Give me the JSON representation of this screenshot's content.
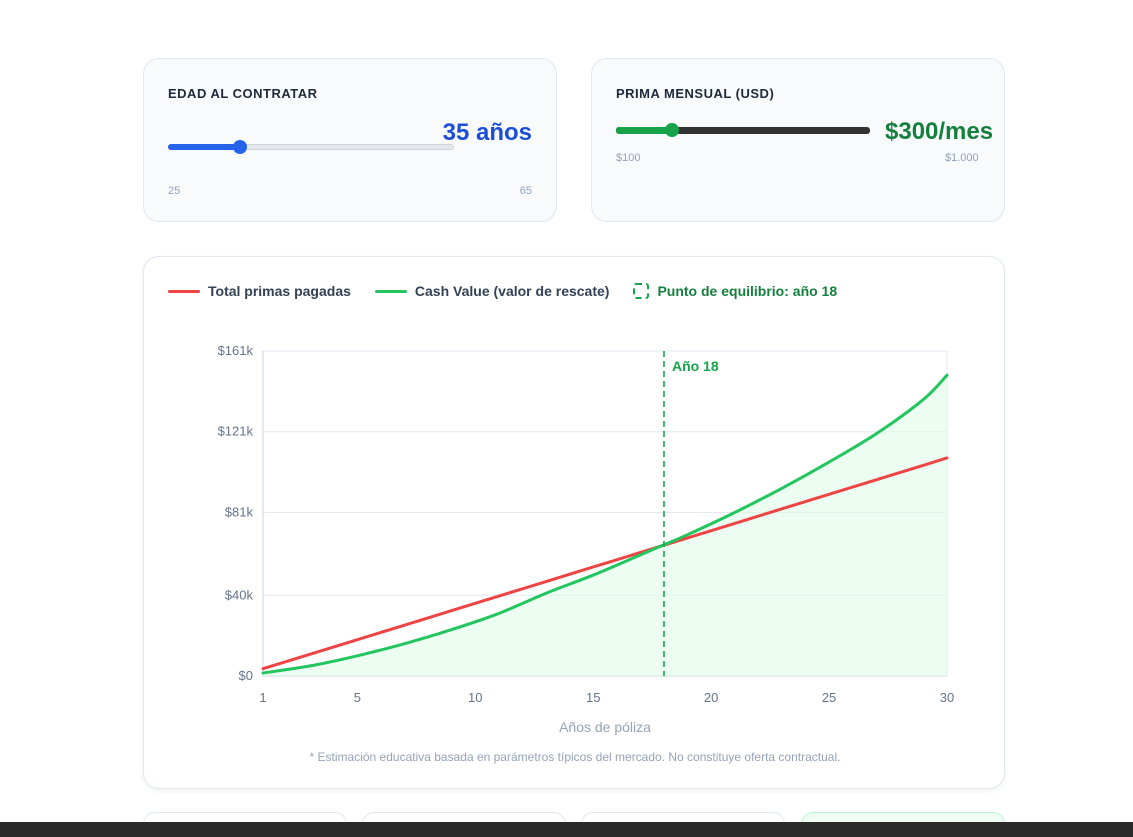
{
  "age": {
    "title": "EDAD AL CONTRATAR",
    "value": 35,
    "min": 25,
    "max": 65,
    "display": "35 años",
    "min_label": "25",
    "max_label": "65",
    "accent": "#1d4ed8"
  },
  "premium": {
    "title": "PRIMA MENSUAL (USD)",
    "value": 300,
    "min": 100,
    "max": 1000,
    "display": "$300/mes",
    "min_label": "$100",
    "max_label": "$1.000",
    "accent": "#16a34a"
  },
  "legend": {
    "premiums": "Total primas pagadas",
    "cash_value": "Cash Value (valor de rescate)",
    "breakeven": "Punto de equilibrio: año 18"
  },
  "footnote": "* Estimación educativa basada en parámetros típicos del mercado. No constituye oferta contractual.",
  "chart_data": {
    "type": "line",
    "xlabel": "Años de póliza",
    "ylabel": "",
    "xlim": [
      1,
      30
    ],
    "ylim": [
      0,
      161
    ],
    "x_ticks": [
      1,
      5,
      10,
      15,
      20,
      25,
      30
    ],
    "y_ticks": [
      {
        "value": 0,
        "label": "$0"
      },
      {
        "value": 40,
        "label": "$40k"
      },
      {
        "value": 81,
        "label": "$81k"
      },
      {
        "value": 121,
        "label": "$121k"
      },
      {
        "value": 161,
        "label": "$161k"
      }
    ],
    "x": [
      1,
      3,
      5,
      7,
      9,
      11,
      13,
      15,
      17,
      18,
      19,
      21,
      23,
      25,
      27,
      29,
      30
    ],
    "series": [
      {
        "name": "Total primas pagadas",
        "color": "#ef4444",
        "values": [
          3.6,
          10.8,
          18,
          25.2,
          32.4,
          39.6,
          46.8,
          54,
          61.2,
          64.8,
          68.4,
          75.6,
          82.8,
          90,
          97.2,
          104.4,
          108
        ]
      },
      {
        "name": "Cash Value (valor de rescate)",
        "color": "#22c55e",
        "values": [
          1.5,
          5,
          10,
          16,
          23,
          31,
          41,
          50,
          60,
          65,
          70,
          81,
          93,
          106,
          120,
          137,
          149
        ]
      }
    ],
    "breakeven": {
      "x": 18,
      "label": "Año 18",
      "color": "#16a34a"
    },
    "grid": true,
    "legend_position": "top-left"
  }
}
